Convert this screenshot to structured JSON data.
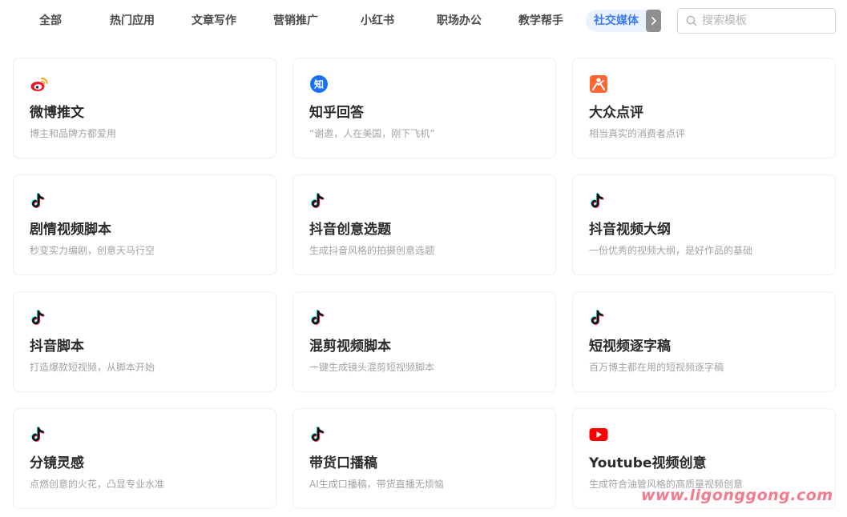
{
  "tabs": [
    {
      "label": "全部"
    },
    {
      "label": "热门应用"
    },
    {
      "label": "文章写作"
    },
    {
      "label": "营销推广"
    },
    {
      "label": "小红书"
    },
    {
      "label": "职场办公"
    },
    {
      "label": "教学帮手"
    },
    {
      "label": "社交媒体"
    }
  ],
  "active_tab": "社交媒体",
  "search": {
    "placeholder": "搜索模板",
    "value": ""
  },
  "accent_color": "#3b7bf6",
  "cards": [
    {
      "title": "微博推文",
      "desc": "博主和品牌方都爱用",
      "icon": "weibo-icon"
    },
    {
      "title": "知乎回答",
      "desc": "“谢邀，人在美国，刚下飞机”",
      "icon": "zhihu-icon"
    },
    {
      "title": "大众点评",
      "desc": "相当真实的消费者点评",
      "icon": "dianping-icon"
    },
    {
      "title": "剧情视频脚本",
      "desc": "秒变实力编剧，创意天马行空",
      "icon": "douyin-icon"
    },
    {
      "title": "抖音创意选题",
      "desc": "生成抖音风格的拍摄创意选题",
      "icon": "douyin-icon"
    },
    {
      "title": "抖音视频大纲",
      "desc": "一份优秀的视频大纲，是好作品的基础",
      "icon": "douyin-icon"
    },
    {
      "title": "抖音脚本",
      "desc": "打造爆款短视频，从脚本开始",
      "icon": "douyin-icon"
    },
    {
      "title": "混剪视频脚本",
      "desc": "一键生成镜头混剪短视频脚本",
      "icon": "douyin-icon"
    },
    {
      "title": "短视频逐字稿",
      "desc": "百万博主都在用的短视频逐字稿",
      "icon": "douyin-icon"
    },
    {
      "title": "分镜灵感",
      "desc": "点燃创意的火花，凸显专业水准",
      "icon": "douyin-icon"
    },
    {
      "title": "带货口播稿",
      "desc": "AI生成口播稿，带货直播无烦恼",
      "icon": "douyin-icon"
    },
    {
      "title": "Youtube视频创意",
      "desc": "生成符合油管风格的高质量视频创意",
      "icon": "youtube-icon"
    }
  ],
  "watermark": "www.ligonggong.com"
}
